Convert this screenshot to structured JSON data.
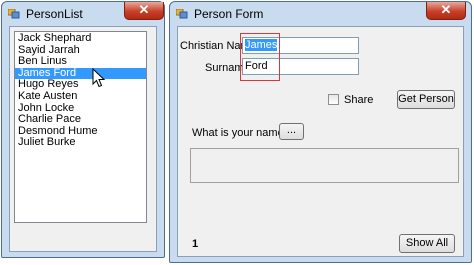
{
  "person_list_window": {
    "title": "PersonList",
    "close_glyph": "✕",
    "items": [
      "Jack Shephard",
      "Sayid Jarrah",
      "Ben Linus",
      "James Ford",
      "Hugo Reyes",
      "Kate Austen",
      "John Locke",
      "Charlie Pace",
      "Desmond Hume",
      "Juliet Burke"
    ],
    "selected_item": "James Ford"
  },
  "person_form_window": {
    "title": "Person Form",
    "close_glyph": "✕",
    "christian_name_label": "Christian Name:",
    "christian_name_value": "James",
    "surname_label": "Surname:",
    "surname_value": "Ford",
    "share_label": "Share",
    "share_checked": false,
    "get_person_button": "Get Person",
    "question_label": "What is your name?",
    "ellipsis_button": "...",
    "counter": "1",
    "show_all_button": "Show All"
  },
  "colors": {
    "frame": "#c9dbee",
    "selection": "#3399ff",
    "close_button": "#c7402a",
    "highlight_box": "#d9363e"
  },
  "icons": [
    "app-icon",
    "close-icon",
    "checkbox-icon",
    "mouse-pointer-icon"
  ]
}
